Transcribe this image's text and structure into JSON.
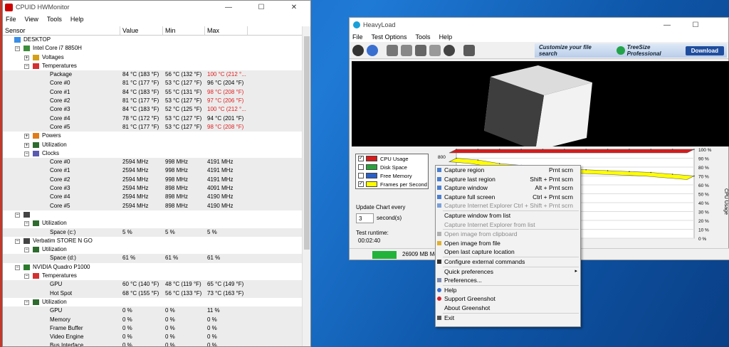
{
  "hwmonitor": {
    "title": "CPUID HWMonitor",
    "menu": [
      "File",
      "View",
      "Tools",
      "Help"
    ],
    "columns": [
      "Sensor",
      "Value",
      "Min",
      "Max"
    ],
    "rows": [
      {
        "label": "DESKTOP",
        "level": 0,
        "icon": "computer-icon",
        "expander": ""
      },
      {
        "label": "Intel Core i7 8850H",
        "level": 1,
        "icon": "cpu-icon",
        "expander": "−"
      },
      {
        "label": "Voltages",
        "level": 2,
        "icon": "voltage-icon",
        "expander": "+"
      },
      {
        "label": "Temperatures",
        "level": 2,
        "icon": "thermometer-icon",
        "expander": "−"
      },
      {
        "label": "Package",
        "level": 3,
        "value": "84 °C  (183 °F)",
        "min": "56 °C  (132 °F)",
        "max": "100 °C  (212 °...",
        "maxRed": true
      },
      {
        "label": "Core #0",
        "level": 3,
        "value": "81 °C  (177 °F)",
        "min": "53 °C  (127 °F)",
        "max": "96 °C  (204 °F)",
        "maxRed": false
      },
      {
        "label": "Core #1",
        "level": 3,
        "value": "84 °C  (183 °F)",
        "min": "55 °C  (131 °F)",
        "max": "98 °C  (208 °F)",
        "maxRed": true
      },
      {
        "label": "Core #2",
        "level": 3,
        "value": "81 °C  (177 °F)",
        "min": "53 °C  (127 °F)",
        "max": "97 °C  (206 °F)",
        "maxRed": true
      },
      {
        "label": "Core #3",
        "level": 3,
        "value": "84 °C  (183 °F)",
        "min": "52 °C  (125 °F)",
        "max": "100 °C  (212 °...",
        "maxRed": true
      },
      {
        "label": "Core #4",
        "level": 3,
        "value": "78 °C  (172 °F)",
        "min": "53 °C  (127 °F)",
        "max": "94 °C  (201 °F)",
        "maxRed": false
      },
      {
        "label": "Core #5",
        "level": 3,
        "value": "81 °C  (177 °F)",
        "min": "53 °C  (127 °F)",
        "max": "98 °C  (208 °F)",
        "maxRed": true
      },
      {
        "label": "Powers",
        "level": 2,
        "icon": "power-icon",
        "expander": "+"
      },
      {
        "label": "Utilization",
        "level": 2,
        "icon": "utilization-icon",
        "expander": "+"
      },
      {
        "label": "Clocks",
        "level": 2,
        "icon": "clock-icon",
        "expander": "−"
      },
      {
        "label": "Core #0",
        "level": 3,
        "value": "2594 MHz",
        "min": "998 MHz",
        "max": "4191 MHz"
      },
      {
        "label": "Core #1",
        "level": 3,
        "value": "2594 MHz",
        "min": "998 MHz",
        "max": "4191 MHz"
      },
      {
        "label": "Core #2",
        "level": 3,
        "value": "2594 MHz",
        "min": "998 MHz",
        "max": "4191 MHz"
      },
      {
        "label": "Core #3",
        "level": 3,
        "value": "2594 MHz",
        "min": "898 MHz",
        "max": "4091 MHz"
      },
      {
        "label": "Core #4",
        "level": 3,
        "value": "2594 MHz",
        "min": "898 MHz",
        "max": "4190 MHz"
      },
      {
        "label": "Core #5",
        "level": 3,
        "value": "2594 MHz",
        "min": "898 MHz",
        "max": "4190 MHz"
      },
      {
        "label": "",
        "level": 1,
        "icon": "drive-icon",
        "expander": "−"
      },
      {
        "label": "Utilization",
        "level": 2,
        "icon": "utilization-icon",
        "expander": "−"
      },
      {
        "label": "Space (c:)",
        "level": 3,
        "value": "5 %",
        "min": "5 %",
        "max": "5 %"
      },
      {
        "label": "Verbatim STORE N GO",
        "level": 1,
        "icon": "drive-icon",
        "expander": "−"
      },
      {
        "label": "Utilization",
        "level": 2,
        "icon": "utilization-icon",
        "expander": "−"
      },
      {
        "label": "Space (d:)",
        "level": 3,
        "value": "61 %",
        "min": "61 %",
        "max": "61 %"
      },
      {
        "label": "NVIDIA Quadro P1000",
        "level": 1,
        "icon": "gpu-icon",
        "expander": "−"
      },
      {
        "label": "Temperatures",
        "level": 2,
        "icon": "thermometer-icon",
        "expander": "−"
      },
      {
        "label": "GPU",
        "level": 3,
        "value": "60 °C  (140 °F)",
        "min": "48 °C  (119 °F)",
        "max": "65 °C  (149 °F)"
      },
      {
        "label": "Hot Spot",
        "level": 3,
        "value": "68 °C  (155 °F)",
        "min": "56 °C  (133 °F)",
        "max": "73 °C  (163 °F)"
      },
      {
        "label": "Utilization",
        "level": 2,
        "icon": "utilization-icon",
        "expander": "−"
      },
      {
        "label": "GPU",
        "level": 3,
        "value": "0 %",
        "min": "0 %",
        "max": "11 %"
      },
      {
        "label": "Memory",
        "level": 3,
        "value": "0 %",
        "min": "0 %",
        "max": "0 %"
      },
      {
        "label": "Frame Buffer",
        "level": 3,
        "value": "0 %",
        "min": "0 %",
        "max": "0 %"
      },
      {
        "label": "Video Engine",
        "level": 3,
        "value": "0 %",
        "min": "0 %",
        "max": "0 %"
      },
      {
        "label": "Bus Interface",
        "level": 3,
        "value": "0 %",
        "min": "0 %",
        "max": "0 %"
      }
    ]
  },
  "heavyload": {
    "title": "HeavyLoad",
    "menu": [
      "File",
      "Test Options",
      "Tools",
      "Help"
    ],
    "ad": {
      "text": "Customize your file search",
      "brand": "TreeSize Professional",
      "button": "Download"
    },
    "legend": [
      {
        "label": "CPU Usage",
        "checked": true,
        "color": "#d81b1b"
      },
      {
        "label": "Disk Space",
        "checked": false,
        "color": "#27a33a"
      },
      {
        "label": "Free Memory",
        "checked": false,
        "color": "#2a5fc8"
      },
      {
        "label": "Frames per Second",
        "checked": true,
        "color": "#ffff00"
      }
    ],
    "update_label": "Update Chart every",
    "update_value": "3",
    "update_unit": "second(s)",
    "runtime_label": "Test runtime:",
    "runtime_value": "00:02:40",
    "memory_status": "26909 MB Me",
    "chart_left_label": "800",
    "chart_right_ticks": [
      "100 %",
      "90 %",
      "80 %",
      "70 %",
      "60 %",
      "50 %",
      "40 %",
      "30 %",
      "20 %",
      "10 %",
      "0 %"
    ],
    "chart_axis_title": "CPU Usage"
  },
  "chart_data": {
    "type": "line",
    "series": [
      {
        "name": "CPU Usage",
        "color": "#d81b1b",
        "values": [
          100,
          100,
          100,
          100,
          100,
          100,
          100,
          100,
          100,
          100,
          100,
          100
        ]
      },
      {
        "name": "Frames per Second",
        "color": "#ffff00",
        "values": [
          90,
          88,
          84,
          82,
          80,
          78,
          77,
          76,
          75,
          74,
          72,
          70
        ]
      }
    ],
    "ylim": [
      0,
      100
    ],
    "y_ticks": [
      "100 %",
      "90 %",
      "80 %",
      "70 %",
      "60 %",
      "50 %",
      "40 %",
      "30 %",
      "20 %",
      "10 %",
      "0 %"
    ],
    "ylabel": "CPU Usage"
  },
  "context_menu": {
    "items": [
      {
        "label": "Capture region",
        "shortcut": "Prnt scrn",
        "disabled": false,
        "icon": "region-icon"
      },
      {
        "label": "Capture last region",
        "shortcut": "Shift + Prnt scrn",
        "disabled": false,
        "icon": "last-region-icon"
      },
      {
        "label": "Capture window",
        "shortcut": "Alt + Prnt scrn",
        "disabled": false,
        "icon": "window-icon"
      },
      {
        "label": "Capture full screen",
        "shortcut": "Ctrl + Prnt scrn",
        "disabled": false,
        "icon": "fullscreen-icon"
      },
      {
        "label": "Capture Internet Explorer",
        "shortcut": "Ctrl + Shift + Prnt scrn",
        "disabled": true,
        "icon": "ie-icon"
      },
      {
        "sep": true
      },
      {
        "label": "Capture window from list",
        "shortcut": "",
        "disabled": false
      },
      {
        "label": "Capture Internet Explorer from list",
        "shortcut": "",
        "disabled": true
      },
      {
        "sep": true
      },
      {
        "label": "Open image from clipboard",
        "shortcut": "",
        "disabled": true,
        "icon": "clipboard-icon"
      },
      {
        "label": "Open image from file",
        "shortcut": "",
        "disabled": false,
        "icon": "folder-icon"
      },
      {
        "label": "Open last capture location",
        "shortcut": "",
        "disabled": false
      },
      {
        "sep": true
      },
      {
        "label": "Configure external commands",
        "shortcut": "",
        "disabled": false,
        "icon": "command-icon"
      },
      {
        "sep": true
      },
      {
        "label": "Quick preferences",
        "shortcut": "",
        "disabled": false,
        "submenu": true
      },
      {
        "label": "Preferences...",
        "shortcut": "",
        "disabled": false,
        "icon": "preferences-icon"
      },
      {
        "sep": true
      },
      {
        "label": "Help",
        "shortcut": "",
        "disabled": false,
        "icon": "help-icon"
      },
      {
        "label": "Support Greenshot",
        "shortcut": "",
        "disabled": false,
        "icon": "heart-icon"
      },
      {
        "label": "About Greenshot",
        "shortcut": "",
        "disabled": false
      },
      {
        "sep": true
      },
      {
        "label": "Exit",
        "shortcut": "",
        "disabled": false,
        "icon": "exit-icon"
      }
    ]
  }
}
